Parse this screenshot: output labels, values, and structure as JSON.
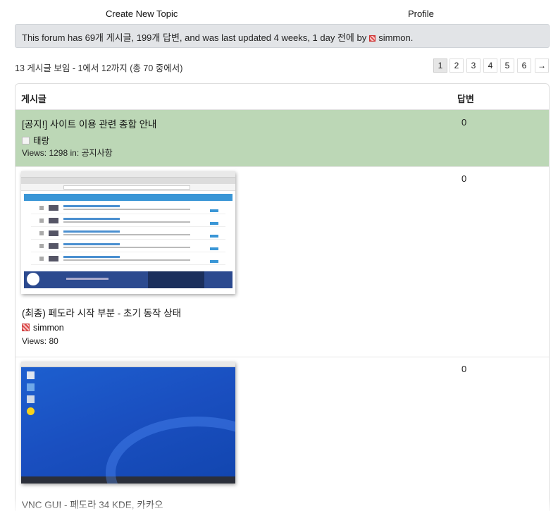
{
  "nav": {
    "create_topic": "Create New Topic",
    "profile": "Profile"
  },
  "notice": {
    "text_before": "This forum has 69개 게시글, 199개 답변, and was last updated 4 weeks, 1 day 전에 by",
    "user": "simmon",
    "text_after": "."
  },
  "counter": "13 게시글 보임 - 1에서 12까지 (총 70 중에서)",
  "pagination": {
    "pages": [
      "1",
      "2",
      "3",
      "4",
      "5",
      "6"
    ],
    "current": "1",
    "next": "→"
  },
  "table": {
    "col_topic": "게시글",
    "col_replies": "답변"
  },
  "topics": [
    {
      "title": "[공지!] 사이트 이용 관련 종합 안내",
      "author": "태랑",
      "views_label": "Views: 1298 in: 공지사항",
      "replies": "0",
      "sticky": true
    },
    {
      "title": "(최종) 페도라 시작 부분 - 초기 동작 상태",
      "author": "simmon",
      "views_label": "Views: 80",
      "replies": "0",
      "thumbnail": "browser-screenshot"
    },
    {
      "title": "VNC GUI - 페도라 34 KDE, 카카오",
      "replies": "0",
      "thumbnail": "desktop-screenshot"
    }
  ],
  "colors": {
    "sticky_row": "#bcd7b6",
    "notice_bg": "#e2e4e7",
    "desktop_blue": "#1a4fc0",
    "browser_menu": "#3a96d6"
  }
}
